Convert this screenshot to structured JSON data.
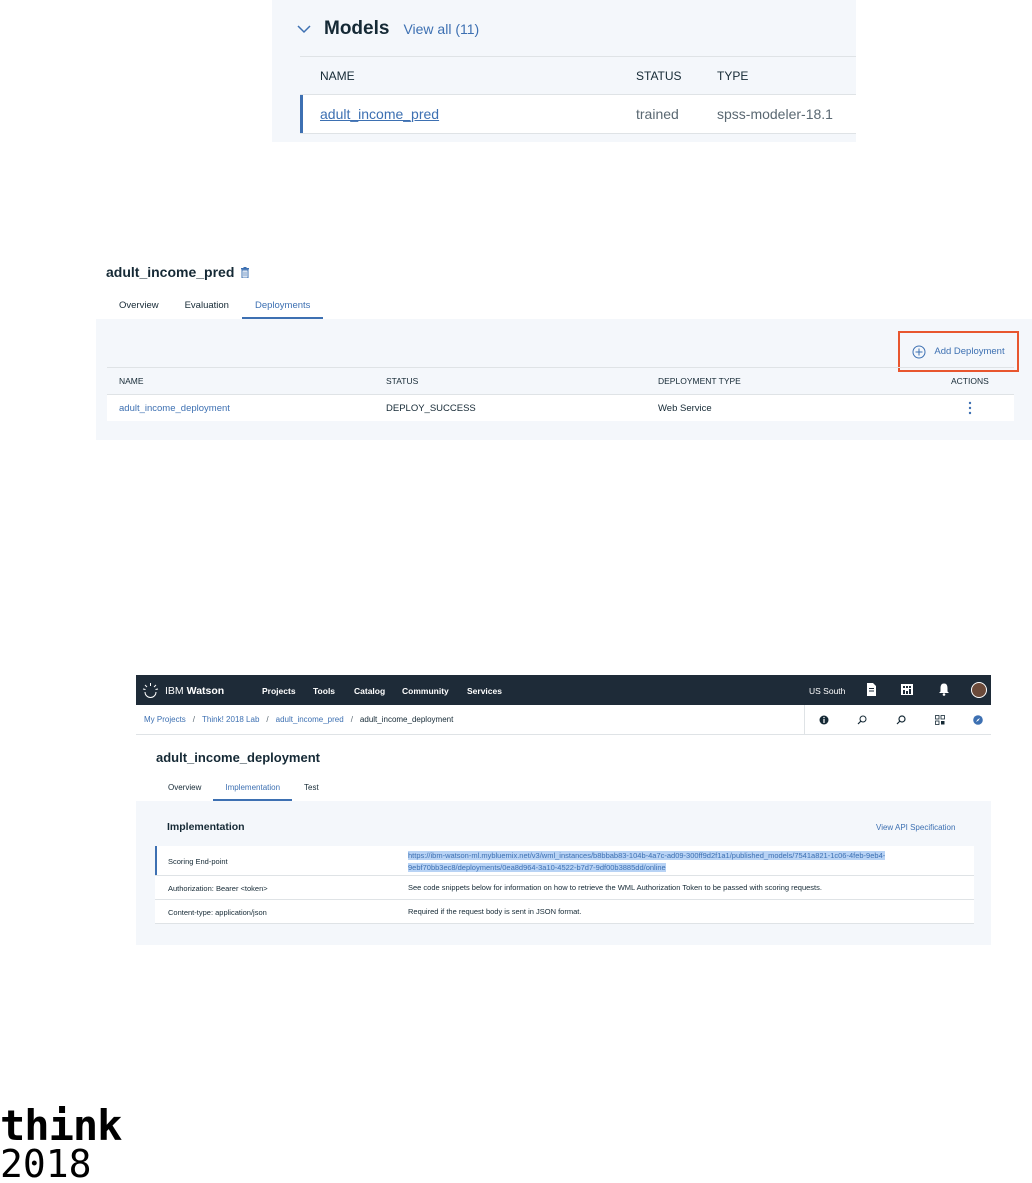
{
  "models_panel": {
    "title": "Models",
    "view_all": "View all (11)",
    "columns": [
      "NAME",
      "STATUS",
      "TYPE"
    ],
    "rows": [
      {
        "name": "adult_income_pred",
        "status": "trained",
        "type": "spss-modeler-18.1"
      }
    ]
  },
  "model_detail": {
    "title": "adult_income_pred",
    "tabs": [
      "Overview",
      "Evaluation",
      "Deployments"
    ],
    "active_tab": "Deployments",
    "add_button": "Add Deployment",
    "columns": [
      "NAME",
      "STATUS",
      "DEPLOYMENT TYPE",
      "ACTIONS"
    ],
    "rows": [
      {
        "name": "adult_income_deployment",
        "status": "DEPLOY_SUCCESS",
        "type": "Web Service"
      }
    ]
  },
  "deployment_detail": {
    "topbar": {
      "brand_prefix": "IBM",
      "brand_name": "Watson",
      "nav": [
        "Projects",
        "Tools",
        "Catalog",
        "Community",
        "Services"
      ],
      "region": "US South"
    },
    "breadcrumbs": [
      "My Projects",
      "Think! 2018 Lab",
      "adult_income_pred",
      "adult_income_deployment"
    ],
    "title": "adult_income_deployment",
    "tabs": [
      "Overview",
      "Implementation",
      "Test"
    ],
    "active_tab": "Implementation",
    "section_title": "Implementation",
    "api_link": "View API Specification",
    "rows": [
      {
        "key": "Scoring End-point",
        "value": "https://ibm-watson-ml.mybluemix.net/v3/wml_instances/b8bbab83-104b-4a7c-ad09-300ff9d2f1a1/published_models/7541a821-1c06-4feb-9eb4-9ebf70bb3ec8/deployments/0ea8d964-3a10-4522-b7d7-9df00b3885dd/online"
      },
      {
        "key": "Authorization: Bearer <token>",
        "value": "See code snippets below for information on how to retrieve the WML Authorization Token to be passed with scoring requests."
      },
      {
        "key": "Content-type: application/json",
        "value": "Required if the request body is sent in JSON format."
      }
    ]
  },
  "logo": {
    "line1": "think",
    "line2": "2018"
  }
}
